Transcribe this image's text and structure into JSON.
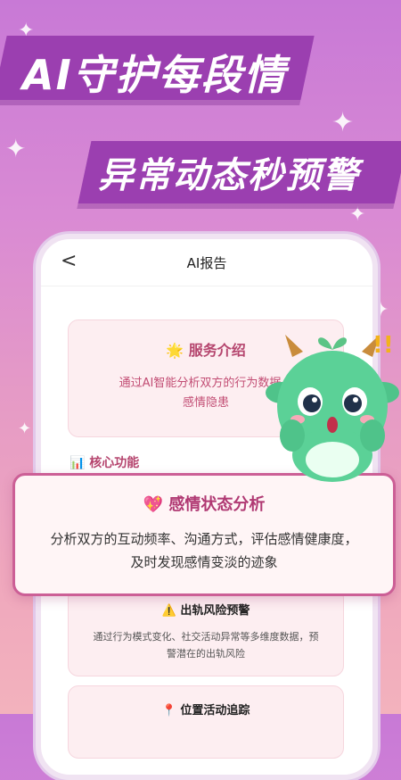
{
  "headline": {
    "line1": "AI守护每段情",
    "line2": "异常动态秒预警"
  },
  "app": {
    "back_label": "<",
    "title": "AI报告"
  },
  "service": {
    "title": "🌟 服务介绍",
    "body_line1": "通过AI智能分析双方的行为数据，",
    "body_line2": "感情隐患"
  },
  "core": {
    "title": "📊 核心功能"
  },
  "overlay": {
    "title": "💖 感情状态分析",
    "line1": "分析双方的互动频率、沟通方式，评估感情健康度，",
    "line2": "及时发现感情变淡的迹象"
  },
  "risk": {
    "title": "⚠️ 出轨风险预警",
    "line1": "通过行为模式变化、社交活动异常等多维度数据，预",
    "line2": "警潜在的出轨风险"
  },
  "location": {
    "title": "📍 位置活动追踪"
  }
}
